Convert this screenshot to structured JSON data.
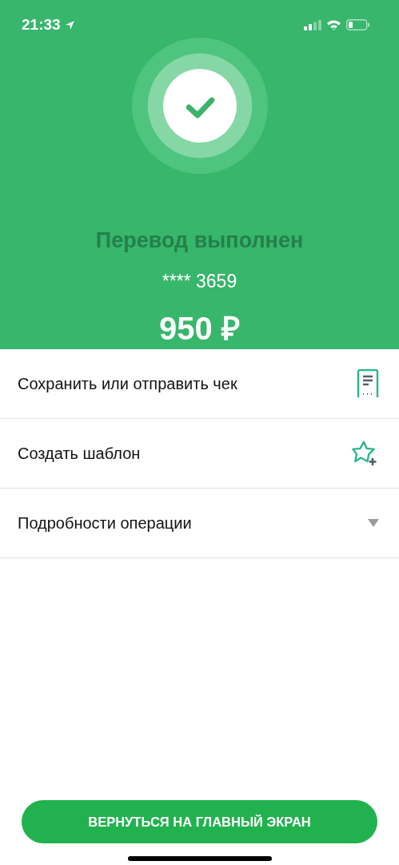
{
  "status_bar": {
    "time": "21:33"
  },
  "result": {
    "title": "Перевод выполнен",
    "card": "**** 3659",
    "amount": "950 ₽"
  },
  "actions": [
    {
      "kind": "receipt",
      "label": "Сохранить или отправить чек"
    },
    {
      "kind": "template",
      "label": "Создать шаблон"
    },
    {
      "kind": "details",
      "label": "Подробности операции",
      "expanded": false
    }
  ],
  "button": {
    "label": "ВЕРНУТЬСЯ НА ГЛАВНЫЙ ЭКРАН"
  }
}
